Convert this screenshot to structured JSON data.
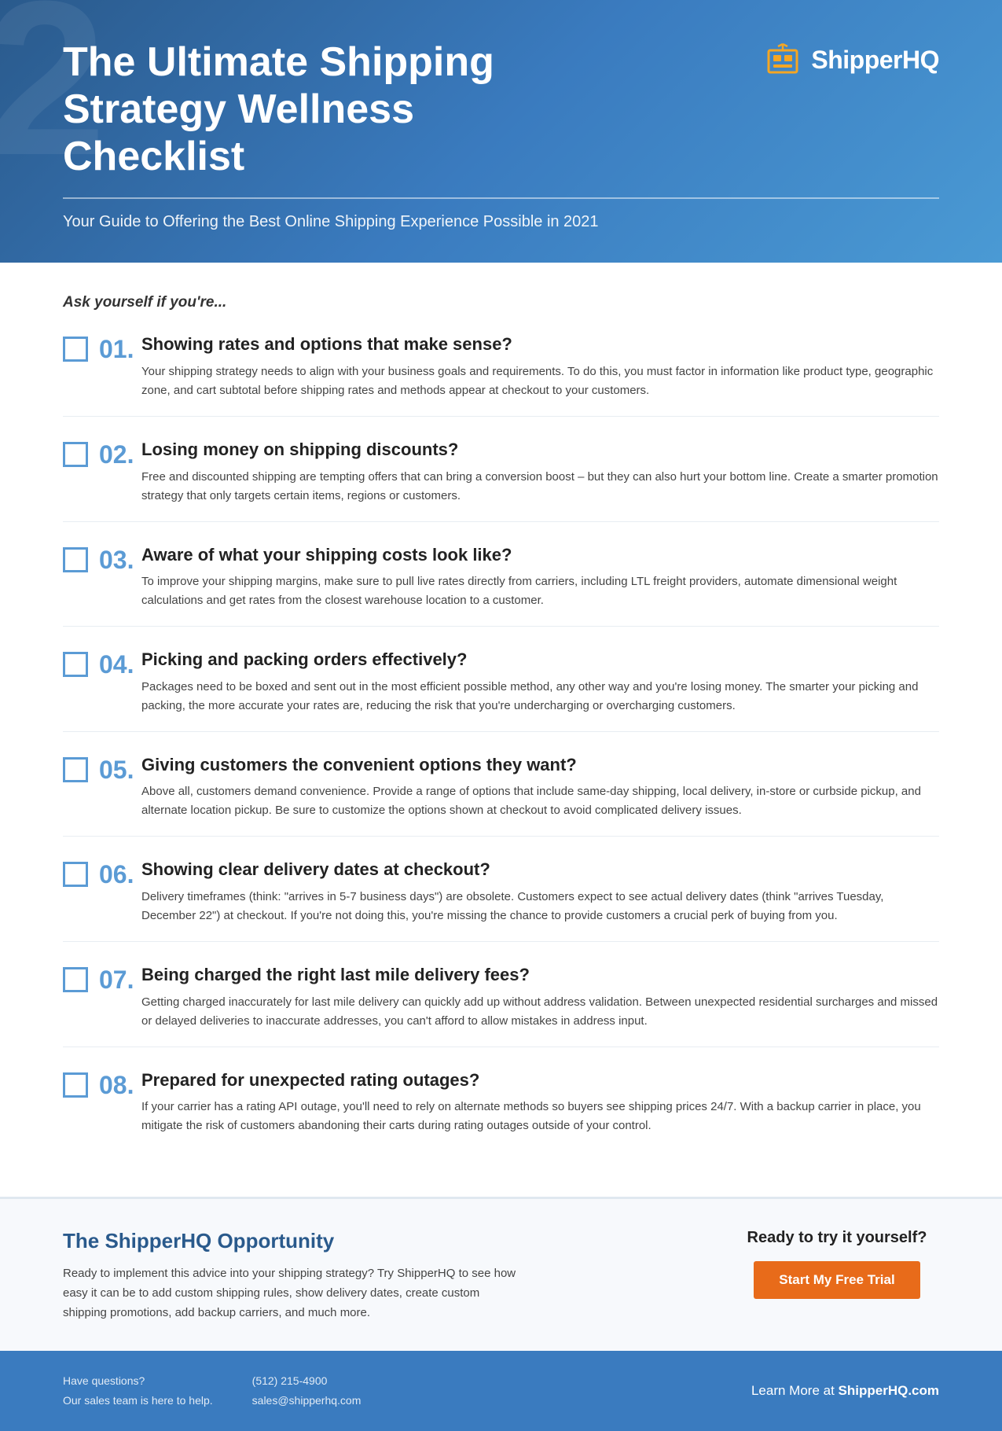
{
  "header": {
    "bg_number": "2",
    "title": "The Ultimate Shipping Strategy Wellness Checklist",
    "subtitle": "Your Guide to Offering the Best Online Shipping Experience Possible in 2021",
    "logo_text": "ShipperHQ"
  },
  "main": {
    "ask_intro": "Ask yourself if you're...",
    "checklist_items": [
      {
        "number": "01.",
        "heading": "Showing rates and options that make sense?",
        "body": "Your shipping strategy needs to align with your business goals and requirements. To do this, you must factor in information like product type, geographic zone, and cart subtotal before shipping rates and methods appear at checkout to your customers."
      },
      {
        "number": "02.",
        "heading": "Losing money on shipping discounts?",
        "body": "Free and discounted shipping are tempting offers that can bring a conversion boost – but they can also hurt your bottom line. Create a smarter promotion strategy that only targets certain items, regions or customers."
      },
      {
        "number": "03.",
        "heading": "Aware of what your shipping costs look like?",
        "body": "To improve your shipping margins, make sure to pull live rates directly from carriers, including LTL freight providers, automate dimensional weight calculations and get rates from the closest warehouse location to a customer."
      },
      {
        "number": "04.",
        "heading": "Picking and packing orders effectively?",
        "body": "Packages need to be boxed and sent out in the most efficient possible method, any other way and you're losing money. The smarter your picking and packing, the more accurate your rates are, reducing the risk that you're undercharging or overcharging customers."
      },
      {
        "number": "05.",
        "heading": "Giving customers the convenient options they want?",
        "body": "Above all, customers demand convenience. Provide a range of options that include same-day shipping, local delivery, in-store or curbside pickup, and alternate location pickup. Be sure to customize the options shown at checkout to avoid complicated delivery issues."
      },
      {
        "number": "06.",
        "heading": "Showing clear delivery dates at checkout?",
        "body": "Delivery timeframes (think: \"arrives in 5-7 business days\") are obsolete. Customers expect to see actual delivery dates (think \"arrives Tuesday, December 22\") at checkout. If you're not doing this, you're missing the chance to provide customers a crucial perk of buying from you."
      },
      {
        "number": "07.",
        "heading": "Being charged the right last mile delivery fees?",
        "body": "Getting charged inaccurately for last mile delivery can quickly add up without address validation. Between unexpected residential surcharges and missed or delayed deliveries to inaccurate addresses, you can't afford to allow mistakes in address input."
      },
      {
        "number": "08.",
        "heading": "Prepared for unexpected rating outages?",
        "body": "If your carrier has a rating API outage, you'll need to rely on alternate methods so buyers see shipping prices 24/7. With a backup carrier in place, you mitigate the risk of customers abandoning their carts during rating outages outside of your control."
      }
    ]
  },
  "opportunity": {
    "title": "The ShipperHQ Opportunity",
    "body": "Ready to implement this advice into your shipping strategy? Try ShipperHQ to see how easy it can be to add custom shipping rules, show delivery dates, create custom shipping promotions, add backup carriers, and much more.",
    "ready_text": "Ready to try it yourself?",
    "cta_label": "Start My Free Trial"
  },
  "footer": {
    "have_questions": "Have questions?",
    "sales_team": "Our sales team is here to help.",
    "phone": "(512) 215-4900",
    "email": "sales@shipperhq.com",
    "learn_more": "Learn More at ",
    "learn_more_link": "ShipperHQ.com"
  }
}
